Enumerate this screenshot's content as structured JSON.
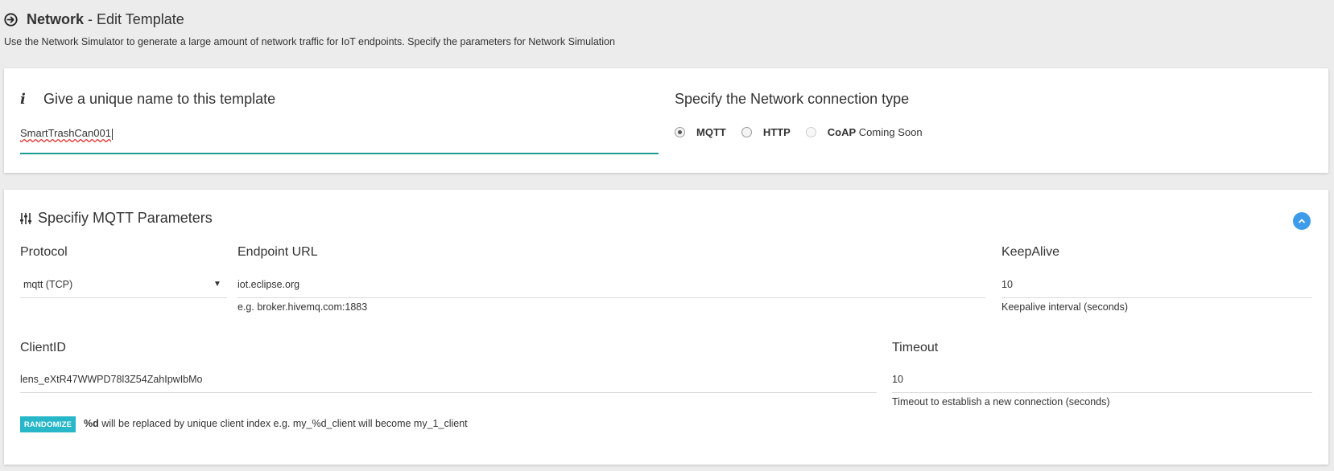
{
  "header": {
    "title_bold": "Network",
    "title_rest": " - Edit Template",
    "subtitle": "Use the Network Simulator to generate a large amount of network traffic for IoT endpoints. Specify the parameters for Network Simulation"
  },
  "template_card": {
    "heading": "Give a unique name to this template",
    "name_value": "SmartTrashCan001",
    "connection_heading": "Specify the Network connection type",
    "connection_types": [
      {
        "label": "MQTT",
        "checked": true
      },
      {
        "label": "HTTP",
        "checked": false
      },
      {
        "label": "CoAP",
        "suffix": " Coming Soon",
        "disabled": true
      }
    ],
    "accent_color": "#1a9c8f"
  },
  "mqtt_card": {
    "heading": "Specifiy MQTT Parameters",
    "protocol": {
      "label": "Protocol",
      "value": "mqtt (TCP)"
    },
    "endpoint": {
      "label": "Endpoint URL",
      "value": "iot.eclipse.org",
      "help": "e.g. broker.hivemq.com:1883"
    },
    "keepalive": {
      "label": "KeepAlive",
      "value": "10",
      "help": "Keepalive interval (seconds)"
    },
    "clientid": {
      "label": "ClientID",
      "value": "lens_eXtR47WWPD78l3Z54ZahIpwIbMo"
    },
    "randomize_label": "RANDOMIZE",
    "randomize_help_bold": "%d",
    "randomize_help": " will be replaced by unique client index e.g. my_%d_client will become my_1_client",
    "timeout": {
      "label": "Timeout",
      "value": "10",
      "help": "Timeout to establish a new connection (seconds)"
    },
    "collapse_color": "#3d9be9",
    "randomize_color": "#27b7c9"
  }
}
